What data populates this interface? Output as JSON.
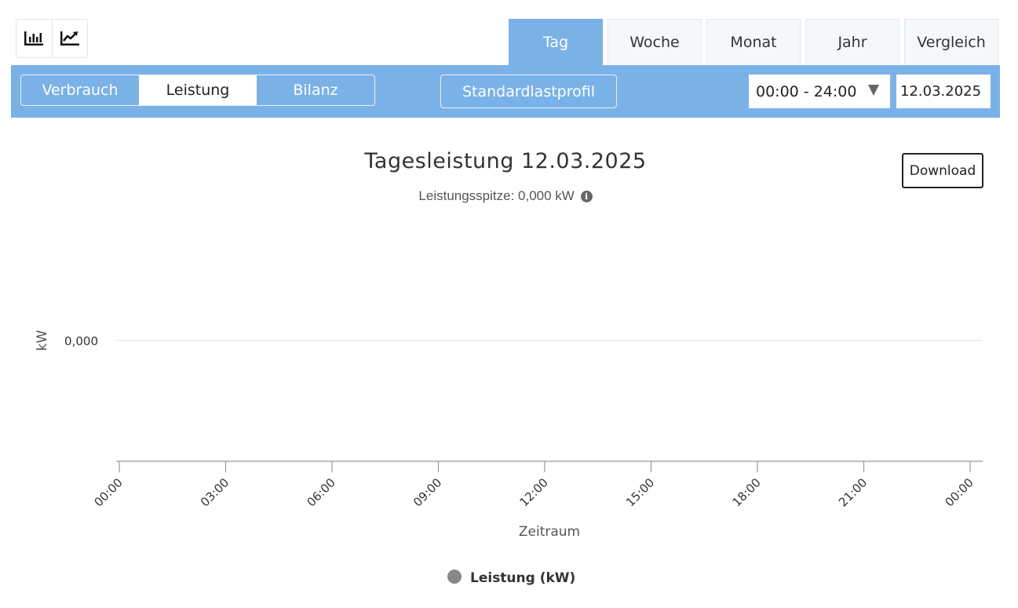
{
  "view_toggle": {
    "items": [
      {
        "icon": "bar-chart-icon"
      },
      {
        "icon": "line-chart-icon"
      }
    ]
  },
  "period_tabs": [
    {
      "label": "Tag",
      "active": true
    },
    {
      "label": "Woche",
      "active": false
    },
    {
      "label": "Monat",
      "active": false
    },
    {
      "label": "Jahr",
      "active": false
    },
    {
      "label": "Vergleich",
      "active": false
    }
  ],
  "toolbar": {
    "modes": [
      {
        "label": "Verbrauch",
        "active": false
      },
      {
        "label": "Leistung",
        "active": true
      },
      {
        "label": "Bilanz",
        "active": false
      }
    ],
    "standard_profile_label": "Standardlastprofil",
    "time_range": "00:00 - 24:00",
    "date": "12.03.2025"
  },
  "download_label": "Download",
  "chart_data": {
    "type": "line",
    "title": "Tagesleistung 12.03.2025",
    "subtitle": "Leistungsspitze: 0,000 kW",
    "ylabel": "kW",
    "xlabel": "Zeitraum",
    "y_tick_labels": [
      "0,000"
    ],
    "x_tick_labels": [
      "00:00",
      "03:00",
      "06:00",
      "09:00",
      "12:00",
      "15:00",
      "18:00",
      "21:00",
      "00:00"
    ],
    "ylim": [
      0,
      0
    ],
    "grid": true,
    "legend_position": "bottom-center",
    "series": [
      {
        "name": "Leistung (kW)",
        "values": [],
        "color": "#888888"
      }
    ]
  },
  "colors": {
    "accent": "#7ab2e8",
    "legend_marker": "#888888"
  }
}
